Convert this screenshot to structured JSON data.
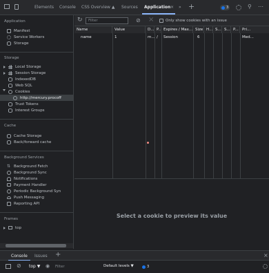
{
  "tabs": {
    "elements": "Elements",
    "console": "Console",
    "css_overview": "CSS Overview ▲",
    "sources": "Sources",
    "application": "Application",
    "more": "»",
    "add": "+",
    "issues_count": "3",
    "menu": "⋯"
  },
  "sidebar": {
    "application_title": "Application",
    "application_items": [
      "Manifest",
      "Service Workers",
      "Storage"
    ],
    "storage_title": "Storage",
    "storage_items": [
      "Local Storage",
      "Session Storage",
      "IndexedDB",
      "Web SQL",
      "Cookies"
    ],
    "cookie_child": "http://mercury.procoff",
    "storage_items_2": [
      "Trust Tokens",
      "Interest Groups"
    ],
    "cache_title": "Cache",
    "cache_items": [
      "Cache Storage",
      "Back/forward cache"
    ],
    "bg_title": "Background Services",
    "bg_items": [
      "Background Fetch",
      "Background Sync",
      "Notifications",
      "Payment Handler",
      "Periodic Background Syn",
      "Push Messaging",
      "Reporting API"
    ],
    "frames_title": "Frames",
    "frames_items": [
      "top"
    ]
  },
  "toolbar": {
    "filter_placeholder": "Filter",
    "only_show_issue": "Only show cookies with an issue"
  },
  "table": {
    "columns": [
      "Name",
      "Value",
      "D...",
      "P...",
      "Expires / Max...",
      "Size",
      "H...",
      "S...",
      "S...",
      "P...",
      "Pri..."
    ],
    "rows": [
      [
        "name",
        "1",
        "m...",
        "/",
        "Session",
        "6",
        "",
        "",
        "",
        "",
        "Med..."
      ]
    ]
  },
  "preview": {
    "text": "Select a cookie to preview its value"
  },
  "drawer": {
    "console_tab": "Console",
    "issues_tab": "Issues",
    "add": "+",
    "close": "×",
    "context": "top ▼",
    "filter_placeholder": "Filter",
    "levels": "Default levels ▼",
    "issues_count": "3"
  },
  "colors": {
    "accent": "#8ab4f8",
    "badge_blue": "#1a73e8",
    "background": "#202124"
  }
}
